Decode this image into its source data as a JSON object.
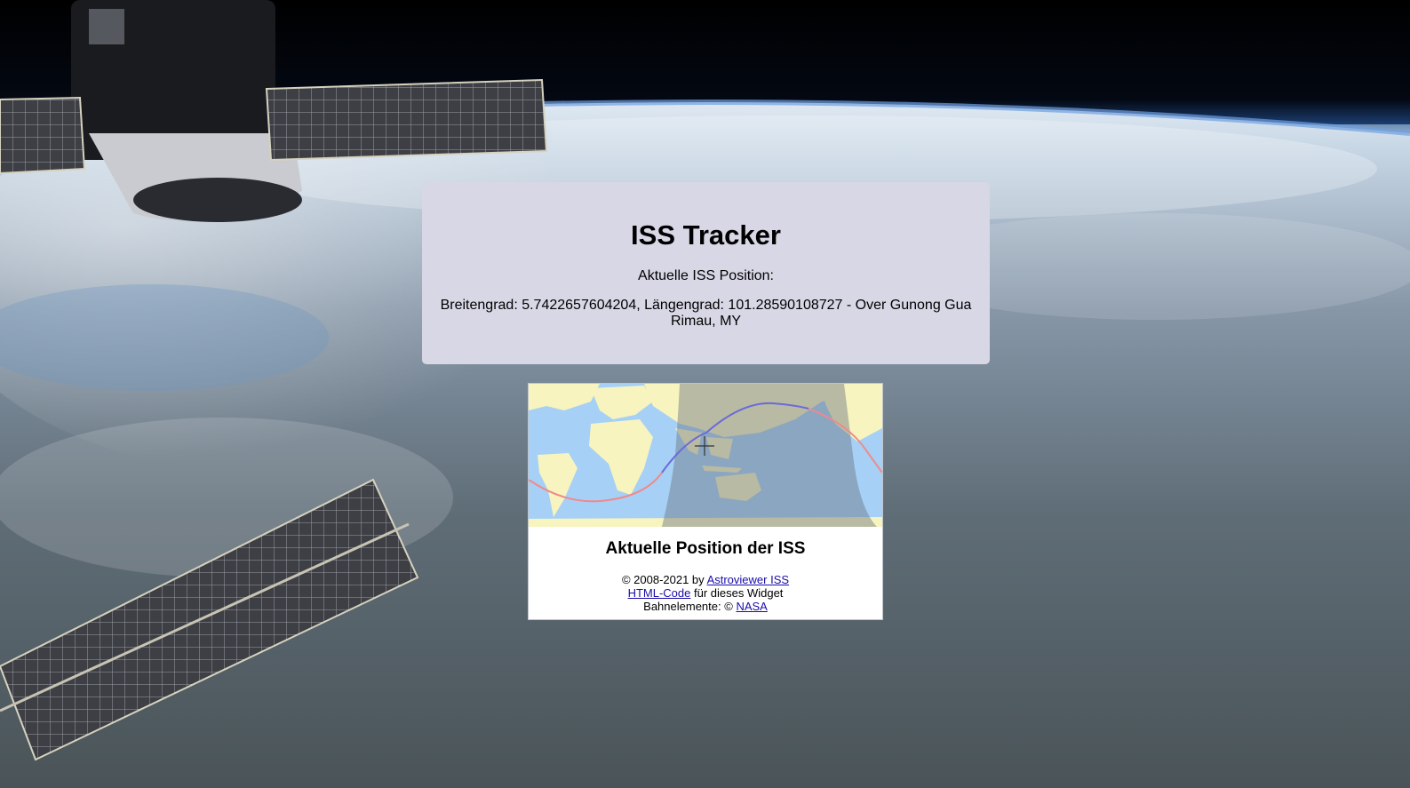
{
  "card": {
    "title": "ISS Tracker",
    "position_label": "Aktuelle ISS Position:",
    "coordinates_text": "Breitengrad: 5.7422657604204, Längengrad: 101.28590108727 - Over Gunong Gua Rimau, MY"
  },
  "widget": {
    "caption": "Aktuelle Position der ISS",
    "copyright_prefix": "© 2008-2021 by",
    "astroviewer_link": "Astroviewer ISS",
    "html_code_link": "HTML-Code",
    "html_code_suffix": "für dieses Widget",
    "orbit_prefix": "Bahnelemente: ©",
    "nasa_link": "NASA"
  },
  "colors": {
    "card_bg": "#d8d7e6",
    "ocean": "#a6d0f5",
    "land": "#f7f4bf",
    "night_shade": "#8d98a0",
    "orbit_past": "#f08a8a",
    "orbit_future": "#6a6ad8",
    "link": "#1a0dab"
  },
  "icons": {
    "iss_marker": "crosshair-icon"
  }
}
